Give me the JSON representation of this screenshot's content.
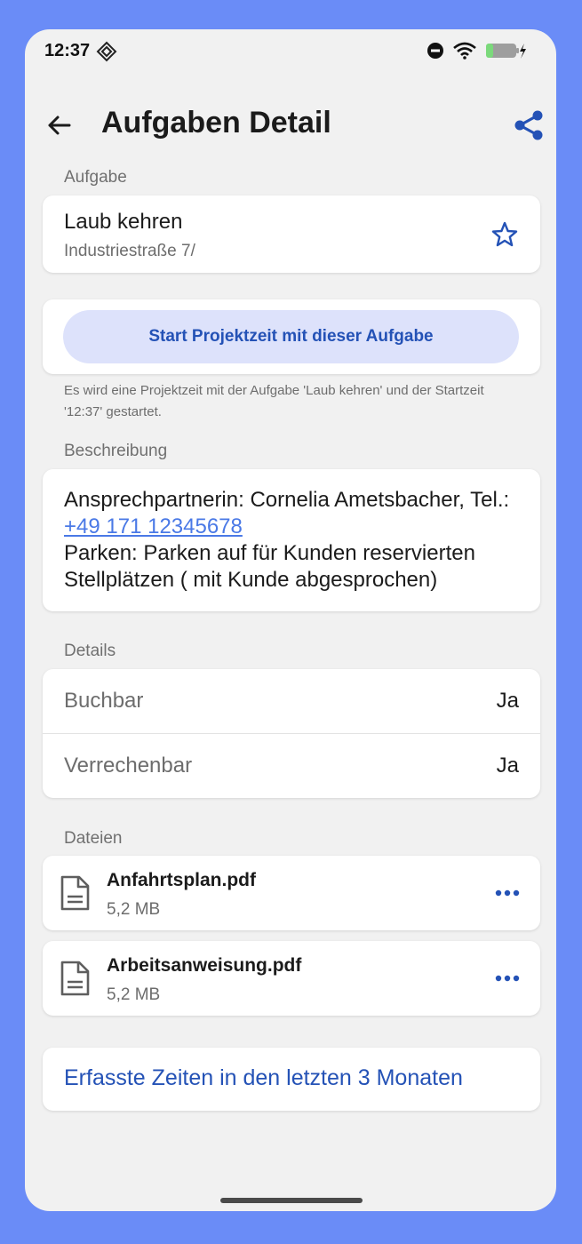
{
  "status_bar": {
    "time": "12:37"
  },
  "header": {
    "title": "Aufgaben Detail"
  },
  "task": {
    "section_label": "Aufgabe",
    "title": "Laub kehren",
    "address": "Industriestraße 7/"
  },
  "project_time": {
    "button_label": "Start Projektzeit mit dieser Aufgabe",
    "hint": "Es wird eine Projektzeit mit der Aufgabe 'Laub kehren' und der Startzeit '12:37' gestartet."
  },
  "description": {
    "section_label": "Beschreibung",
    "contact_prefix": "Ansprechpartnerin: Cornelia Ametsbacher, Tel.: ",
    "phone": "+49 171 12345678",
    "parking": "Parken: Parken auf für Kunden reservierten Stellplätzen ( mit Kunde abgesprochen)"
  },
  "details": {
    "section_label": "Details",
    "rows": [
      {
        "label": "Buchbar",
        "value": "Ja"
      },
      {
        "label": "Verrechenbar",
        "value": "Ja"
      }
    ]
  },
  "files": {
    "section_label": "Dateien",
    "items": [
      {
        "name": "Anfahrtsplan.pdf",
        "size": "5,2 MB",
        "icon": "document-icon"
      },
      {
        "name": "Arbeitsanweisung.pdf",
        "size": "5,2 MB",
        "icon": "document-icon"
      }
    ]
  },
  "times": {
    "link_label": "Erfasste Zeiten in den letzten 3 Monaten"
  },
  "colors": {
    "frame_background": "#6a8cf7",
    "accent": "#2452b6",
    "button_fill": "#dde2fb",
    "link": "#4a79e6",
    "page_background": "#f1f1f1"
  }
}
